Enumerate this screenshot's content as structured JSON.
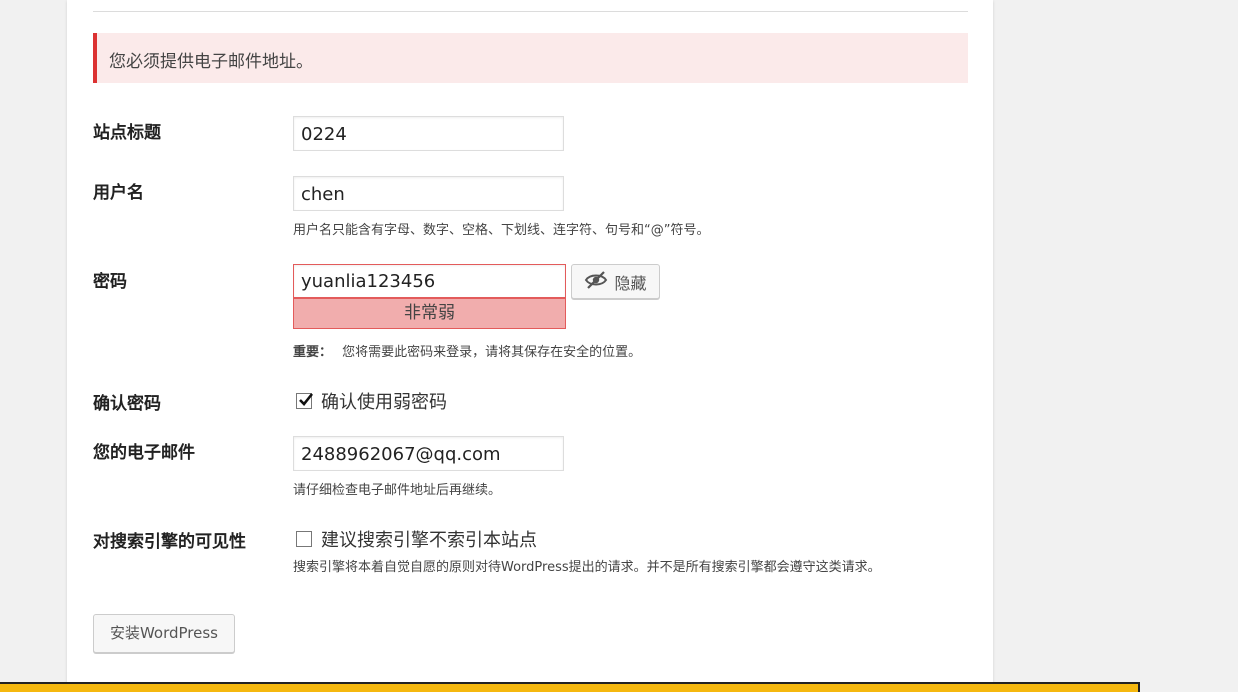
{
  "notice": {
    "error": "您必须提供电子邮件地址。"
  },
  "form": {
    "site_title": {
      "label": "站点标题",
      "value": "0224"
    },
    "username": {
      "label": "用户名",
      "value": "chen",
      "hint": "用户名只能含有字母、数字、空格、下划线、连字符、句号和“@”符号。"
    },
    "password": {
      "label": "密码",
      "value": "yuanlia123456",
      "strength": "非常弱",
      "toggle_label": "隐藏",
      "note_bold": "重要：",
      "note": "您将需要此密码来登录，请将其保存在安全的位置。"
    },
    "confirm_password": {
      "label": "确认密码",
      "checkbox_label": "确认使用弱密码",
      "checked": true
    },
    "email": {
      "label": "您的电子邮件",
      "value": "2488962067@qq.com",
      "hint": "请仔细检查电子邮件地址后再继续。"
    },
    "search_visibility": {
      "label": "对搜索引擎的可见性",
      "checkbox_label": "建议搜索引擎不索引本站点",
      "checked": false,
      "hint": "搜索引擎将本着自觉自愿的原则对待WordPress提出的请求。并不是所有搜索引擎都会遵守这类请求。"
    },
    "install_button": "安装WordPress"
  },
  "icons": {
    "toggle": "eye-slash-icon",
    "check": "checkmark-icon"
  },
  "colors": {
    "error_border": "#dc3232",
    "error_bg": "#fbeaea",
    "weak_bg": "#f1adad",
    "taskbar": "#f5b80f"
  }
}
